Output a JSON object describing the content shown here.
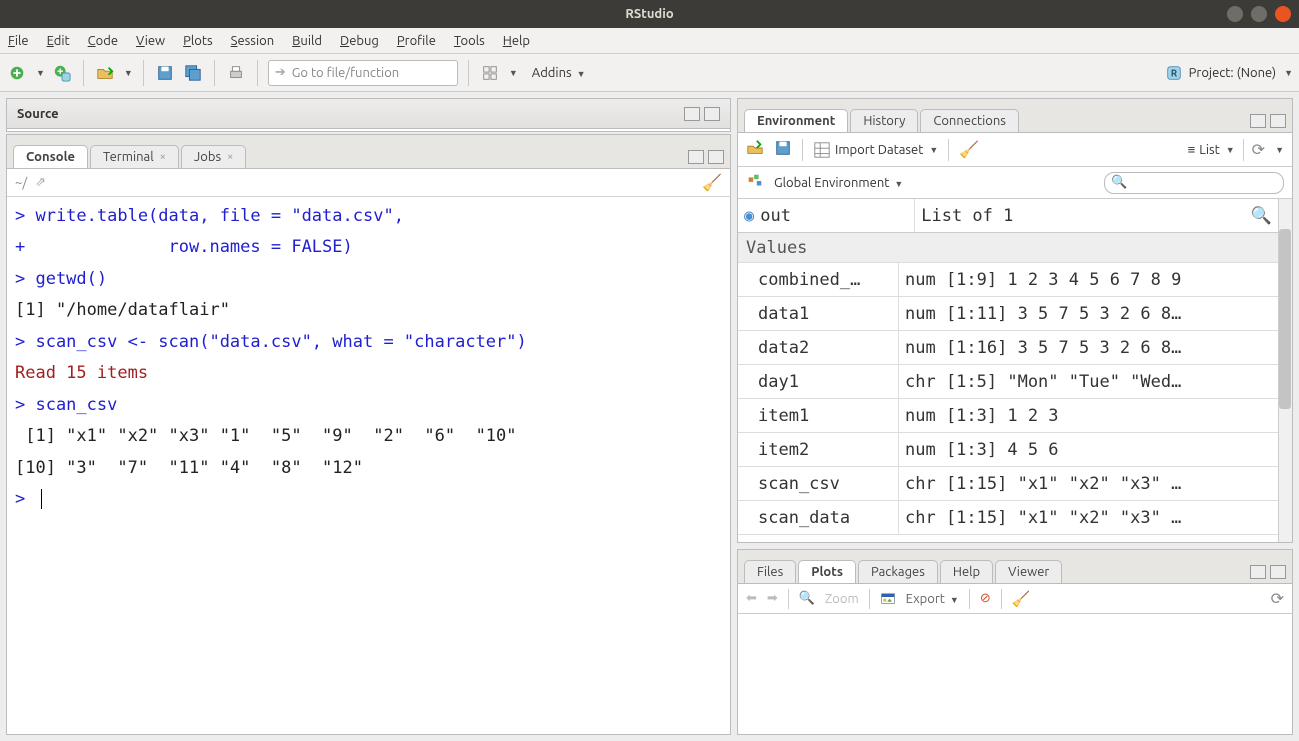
{
  "window": {
    "title": "RStudio"
  },
  "menu": {
    "file": "File",
    "edit": "Edit",
    "code": "Code",
    "view": "View",
    "plots": "Plots",
    "session": "Session",
    "build": "Build",
    "debug": "Debug",
    "profile": "Profile",
    "tools": "Tools",
    "help": "Help"
  },
  "toolbar": {
    "goto_placeholder": "Go to file/function",
    "addins": "Addins",
    "project_label": "Project: (None)"
  },
  "left": {
    "source_title": "Source",
    "tabs": {
      "console": "Console",
      "terminal": "Terminal",
      "jobs": "Jobs"
    },
    "console_prompt_path": "~/",
    "console_lines": [
      {
        "type": "prompt",
        "text": "> write.table(data, file = \"data.csv\","
      },
      {
        "type": "prompt",
        "text": "+              row.names = FALSE)"
      },
      {
        "type": "prompt",
        "text": "> getwd()"
      },
      {
        "type": "output",
        "text": "[1] \"/home/dataflair\""
      },
      {
        "type": "prompt",
        "text": "> scan_csv <- scan(\"data.csv\", what = \"character\")"
      },
      {
        "type": "message",
        "text": "Read 15 items"
      },
      {
        "type": "prompt",
        "text": "> scan_csv"
      },
      {
        "type": "output",
        "text": " [1] \"x1\" \"x2\" \"x3\" \"1\"  \"5\"  \"9\"  \"2\"  \"6\"  \"10\""
      },
      {
        "type": "output",
        "text": "[10] \"3\"  \"7\"  \"11\" \"4\"  \"8\"  \"12\""
      },
      {
        "type": "input",
        "text": "> "
      }
    ]
  },
  "env": {
    "tabs": {
      "environment": "Environment",
      "history": "History",
      "connections": "Connections"
    },
    "import": "Import Dataset",
    "list": "List",
    "scope": "Global Environment",
    "header": {
      "name": "out",
      "value": "List of 1"
    },
    "section": "Values",
    "rows": [
      {
        "name": "combined_…",
        "value": "num [1:9] 1 2 3 4 5 6 7 8 9"
      },
      {
        "name": "data1",
        "value": "num [1:11] 3 5 7 5 3 2 6 8…"
      },
      {
        "name": "data2",
        "value": "num [1:16] 3 5 7 5 3 2 6 8…"
      },
      {
        "name": "day1",
        "value": "chr [1:5] \"Mon\" \"Tue\" \"Wed…"
      },
      {
        "name": "item1",
        "value": "num [1:3] 1 2 3"
      },
      {
        "name": "item2",
        "value": "num [1:3] 4 5 6"
      },
      {
        "name": "scan_csv",
        "value": "chr [1:15] \"x1\" \"x2\" \"x3\" …"
      },
      {
        "name": "scan_data",
        "value": "chr [1:15] \"x1\" \"x2\" \"x3\" …"
      }
    ]
  },
  "plots": {
    "tabs": {
      "files": "Files",
      "plots": "Plots",
      "packages": "Packages",
      "help": "Help",
      "viewer": "Viewer"
    },
    "zoom": "Zoom",
    "export": "Export"
  }
}
